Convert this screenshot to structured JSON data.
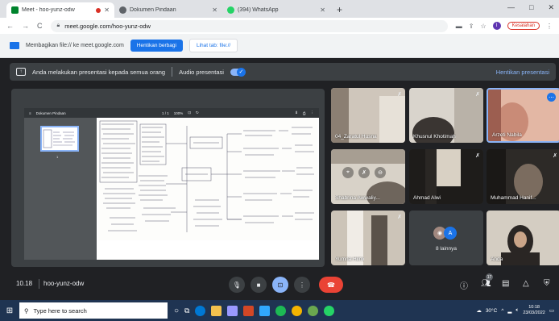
{
  "browser": {
    "tabs": [
      {
        "label": "Meet - hoo-yunz-odw",
        "active": true,
        "recording": true,
        "color": "#00832d"
      },
      {
        "label": "Dokumen Pindaan",
        "active": false,
        "color": "#5f6368"
      },
      {
        "label": "(394) WhatsApp",
        "active": false,
        "color": "#25d366"
      }
    ],
    "new_tab": "+",
    "window_controls": {
      "minimize": "—",
      "maximize": "□",
      "close": "✕"
    },
    "url": "meet.google.com/hoo-yunz-odw",
    "profile_initial": "I",
    "error_label": "Kesalahan"
  },
  "share_bar": {
    "message": "Membagikan file:// ke meet.google.com",
    "stop_label": "Hentikan berbagi",
    "view_label": "Lihat tab: file://"
  },
  "banner": {
    "message": "Anda melakukan presentasi kepada semua orang",
    "audio_label": "Audio presentasi",
    "stop_label": "Hentikan presentasi"
  },
  "presentation": {
    "doc_title": "Dokumen Pindaan",
    "page_counter": "1 / 1",
    "zoom": "100%",
    "thumb_number": "1"
  },
  "participants": [
    {
      "name": "04_Zaratul Husna",
      "muted": true
    },
    {
      "name": "Khusnul Khotimah",
      "muted": true
    },
    {
      "name": "Arzeti Nabila",
      "muted": false,
      "highlight": true
    },
    {
      "name": "Shabrina Awwaliy...",
      "muted": false
    },
    {
      "name": "Ahmad Alwi",
      "muted": true
    },
    {
      "name": "Muhammad Hanif...",
      "muted": true
    },
    {
      "name": "Yumna Hilmi",
      "muted": true
    },
    {
      "name": "8 lainnya",
      "muted": false
    },
    {
      "name": "Anda",
      "muted": false
    }
  ],
  "others_avatar_initial": "A",
  "controls": {
    "time": "10.18",
    "meeting_code": "hoo-yunz-odw",
    "participants_count": "17"
  },
  "taskbar": {
    "search_placeholder": "Type here to search",
    "temperature": "30°C",
    "time": "10:18",
    "date": "23/03/2022"
  }
}
